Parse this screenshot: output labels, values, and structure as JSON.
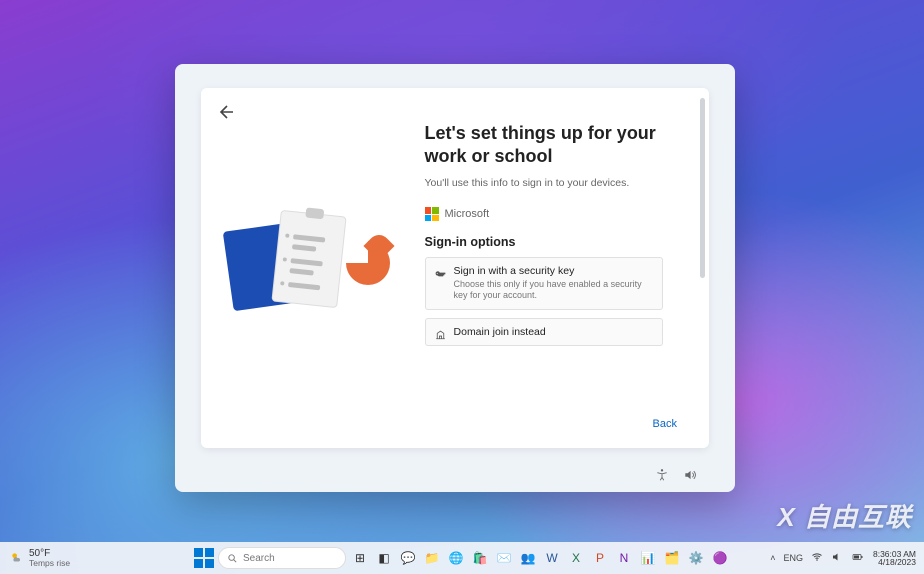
{
  "oobe": {
    "heading": "Let's set things up for your work or school",
    "subtext": "You'll use this info to sign in to your devices.",
    "brand": "Microsoft",
    "signin_title": "Sign-in options",
    "options": [
      {
        "title": "Sign in with a security key",
        "desc": "Choose this only if you have enabled a security key for your account."
      },
      {
        "title": "Domain join instead",
        "desc": ""
      }
    ],
    "back_button": "Back"
  },
  "taskbar": {
    "weather_temp": "50°F",
    "weather_desc": "Temps rise",
    "search_placeholder": "Search",
    "lang": "ENG",
    "time": "8:36:03 AM",
    "date": "4/18/2023"
  },
  "watermark": "X 自由互联"
}
